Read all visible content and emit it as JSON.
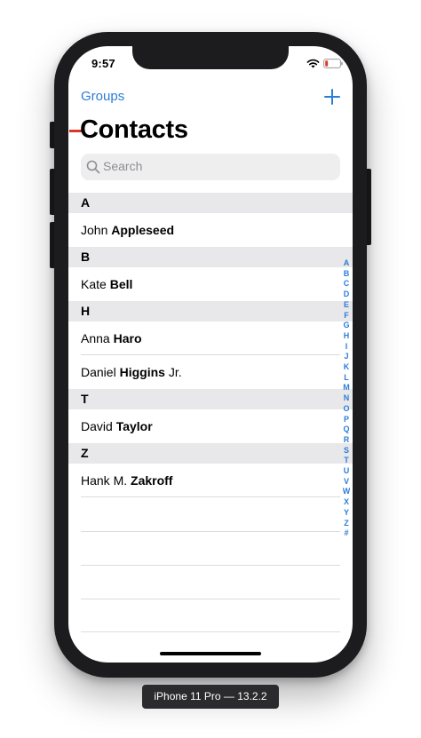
{
  "status_bar": {
    "time": "9:57",
    "icons": [
      "wifi-icon",
      "battery-icon"
    ],
    "battery_color": "#e0392b"
  },
  "nav": {
    "left_label": "Groups",
    "right_icon": "plus-icon",
    "title": "Contacts"
  },
  "search": {
    "placeholder": "Search",
    "icon": "search-icon"
  },
  "sections": [
    {
      "letter": "A",
      "contacts": [
        {
          "first": "John",
          "last": "Appleseed",
          "suffix": ""
        }
      ]
    },
    {
      "letter": "B",
      "contacts": [
        {
          "first": "Kate",
          "last": "Bell",
          "suffix": ""
        }
      ]
    },
    {
      "letter": "H",
      "contacts": [
        {
          "first": "Anna",
          "last": "Haro",
          "suffix": ""
        },
        {
          "first": "Daniel",
          "last": "Higgins",
          "suffix": "Jr."
        }
      ]
    },
    {
      "letter": "T",
      "contacts": [
        {
          "first": "David",
          "last": "Taylor",
          "suffix": ""
        }
      ]
    },
    {
      "letter": "Z",
      "contacts": [
        {
          "first": "Hank M.",
          "last": "Zakroff",
          "suffix": ""
        }
      ]
    }
  ],
  "index_letters": [
    "A",
    "B",
    "C",
    "D",
    "E",
    "F",
    "G",
    "H",
    "I",
    "J",
    "K",
    "L",
    "M",
    "N",
    "O",
    "P",
    "Q",
    "R",
    "S",
    "T",
    "U",
    "V",
    "W",
    "X",
    "Y",
    "Z",
    "#"
  ],
  "device_label": "iPhone 11 Pro — 13.2.2",
  "colors": {
    "accent": "#2b7cd8",
    "section_bg": "#e8e8ea",
    "separator": "#dcdcde",
    "search_bg": "#eeeeef",
    "placeholder": "#8e8e93"
  }
}
